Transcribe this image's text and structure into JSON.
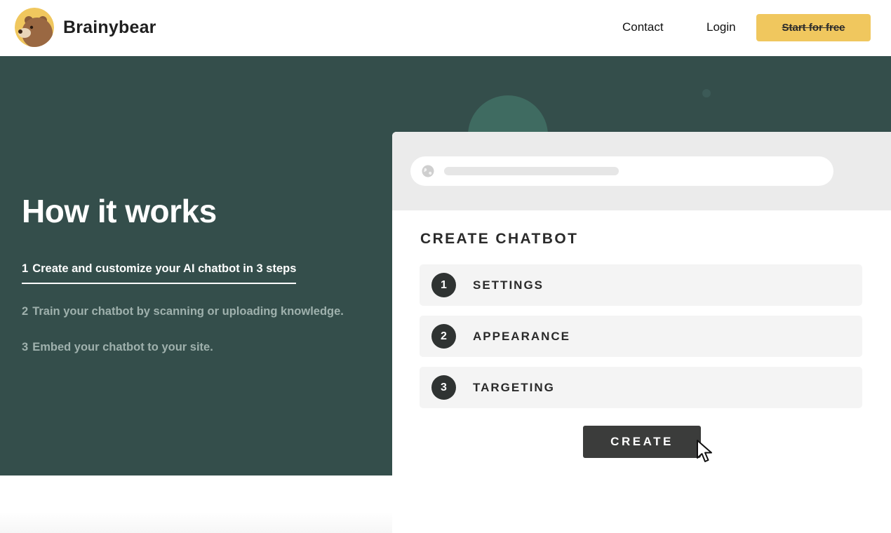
{
  "header": {
    "brand": "Brainybear",
    "nav": {
      "contact": "Contact",
      "login": "Login"
    },
    "cta": "Start for free"
  },
  "hero": {
    "title": "How it works",
    "steps": [
      {
        "num": "1",
        "text": "Create and customize your AI chatbot in 3 steps"
      },
      {
        "num": "2",
        "text": "Train your chatbot by scanning or uploading knowledge."
      },
      {
        "num": "3",
        "text": "Embed your chatbot to your site."
      }
    ]
  },
  "mock": {
    "heading": "CREATE CHATBOT",
    "rows": [
      {
        "num": "1",
        "label": "SETTINGS"
      },
      {
        "num": "2",
        "label": "APPEARANCE"
      },
      {
        "num": "3",
        "label": "TARGETING"
      }
    ],
    "button": "CREATE"
  },
  "icons": {
    "logo": "bear-logo-icon",
    "globe": "globe-icon",
    "cursor": "mouse-pointer-icon"
  },
  "colors": {
    "hero_bg": "#344e4b",
    "accent_yellow": "#f0c75e",
    "dark_button": "#3b3c3b"
  }
}
